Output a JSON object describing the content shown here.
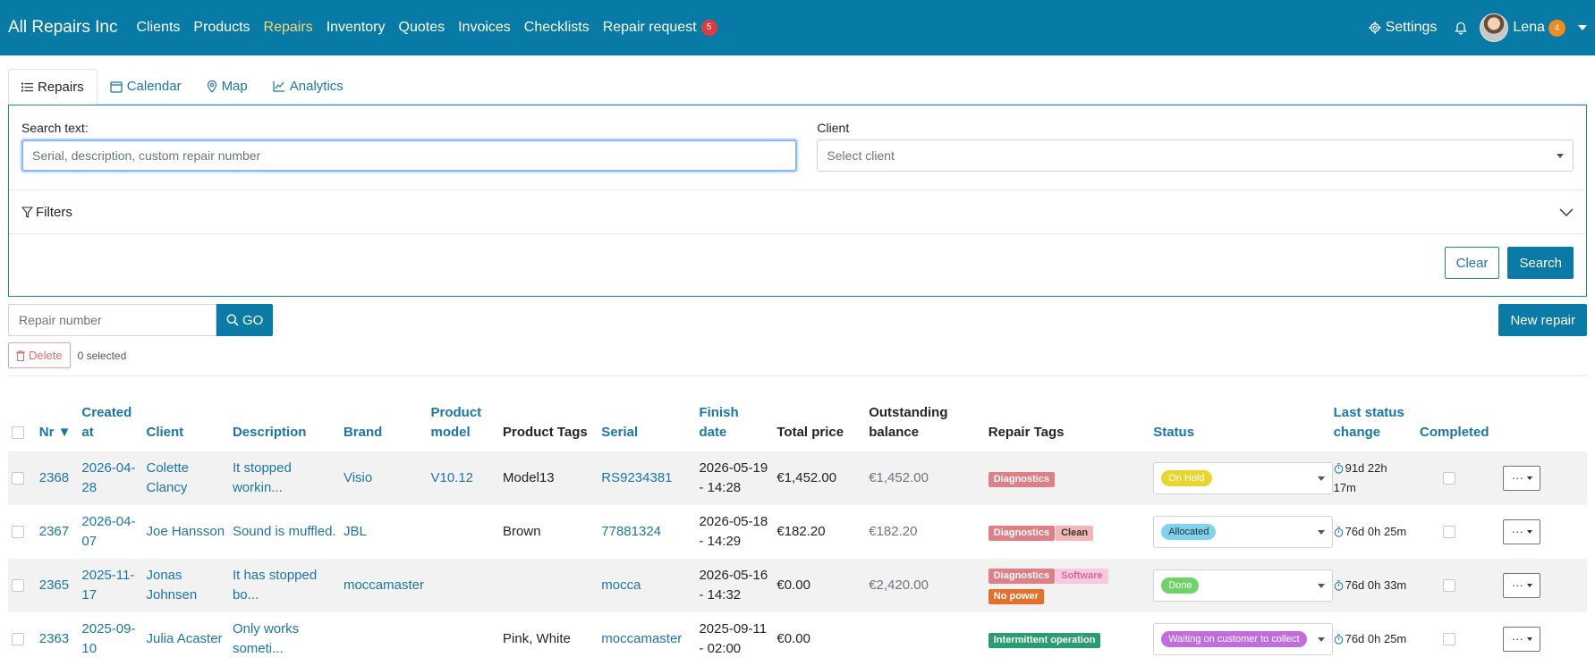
{
  "navbar": {
    "brand": "All Repairs Inc",
    "links": [
      {
        "label": "Clients",
        "active": false
      },
      {
        "label": "Products",
        "active": false
      },
      {
        "label": "Repairs",
        "active": true
      },
      {
        "label": "Inventory",
        "active": false
      },
      {
        "label": "Quotes",
        "active": false
      },
      {
        "label": "Invoices",
        "active": false
      },
      {
        "label": "Checklists",
        "active": false
      }
    ],
    "repair_request_label": "Repair request",
    "repair_request_badge": "5",
    "settings_label": "Settings",
    "user_name": "Lena",
    "user_badge": "4"
  },
  "tabs": [
    {
      "label": "Repairs",
      "icon": "list-icon",
      "active": true
    },
    {
      "label": "Calendar",
      "icon": "calendar-icon",
      "active": false
    },
    {
      "label": "Map",
      "icon": "map-pin-icon",
      "active": false
    },
    {
      "label": "Analytics",
      "icon": "chart-line-icon",
      "active": false
    }
  ],
  "search": {
    "search_label": "Search text:",
    "search_placeholder": "Serial, description, custom repair number",
    "client_label": "Client",
    "client_placeholder": "Select client",
    "filters_label": "Filters",
    "clear_label": "Clear",
    "search_button": "Search"
  },
  "toolbar": {
    "repair_number_placeholder": "Repair number",
    "go_label": "GO",
    "new_repair_label": "New repair",
    "delete_label": "Delete",
    "selected_text": "0 selected"
  },
  "table": {
    "headers": {
      "nr": "Nr ▼",
      "created_at": "Created at",
      "client": "Client",
      "description": "Description",
      "brand": "Brand",
      "product_model": "Product model",
      "product_tags": "Product Tags",
      "serial": "Serial",
      "finish_date": "Finish date",
      "total_price": "Total price",
      "outstanding_balance": "Outstanding balance",
      "repair_tags": "Repair Tags",
      "status": "Status",
      "last_status_change": "Last status change",
      "completed": "Completed"
    },
    "rows": [
      {
        "nr": "2368",
        "created_at": "2026-04-28",
        "client": "Colette Clancy",
        "description": "It stopped workin...",
        "brand": "Visio",
        "product_model": "V10.12",
        "product_tags": "Model13",
        "serial": "RS9234381",
        "finish_date": "2026-05-19 - 14:28",
        "total_price": "€1,452.00",
        "outstanding_balance": "€1,452.00",
        "repair_tags": [
          {
            "label": "Diagnostics",
            "bg": "#e07f85",
            "fg": "#ffffff"
          }
        ],
        "status": {
          "label": "On Hold",
          "bg": "#e9d52f",
          "fg": "#ffffff"
        },
        "last_status_change": "91d 22h 17m"
      },
      {
        "nr": "2367",
        "created_at": "2026-04-07",
        "client": "Joe Hansson",
        "description": "Sound is muffled.",
        "brand": "JBL",
        "product_model": "",
        "product_tags": "Brown",
        "serial": "77881324",
        "finish_date": "2026-05-18 - 14:29",
        "total_price": "€182.20",
        "outstanding_balance": "€182.20",
        "repair_tags": [
          {
            "label": "Diagnostics",
            "bg": "#e07f85",
            "fg": "#ffffff"
          },
          {
            "label": "Clean",
            "bg": "#f2b6b6",
            "fg": "#333333"
          }
        ],
        "status": {
          "label": "Allocated",
          "bg": "#7fd3ea",
          "fg": "#1f2d3a"
        },
        "last_status_change": "76d 0h 25m"
      },
      {
        "nr": "2365",
        "created_at": "2025-11-17",
        "client": "Jonas Johnsen",
        "description": "It has stopped bo...",
        "brand": "moccamaster",
        "product_model": "",
        "product_tags": "",
        "serial": "mocca",
        "finish_date": "2026-05-16 - 14:32",
        "total_price": "€0.00",
        "outstanding_balance": "€2,420.00",
        "repair_tags": [
          {
            "label": "Diagnostics",
            "bg": "#e07f85",
            "fg": "#ffffff"
          },
          {
            "label": "Software",
            "bg": "#f8c9de",
            "fg": "#d06aa0"
          },
          {
            "label": "No power",
            "bg": "#e5702a",
            "fg": "#ffffff"
          }
        ],
        "status": {
          "label": "Done",
          "bg": "#6fd36a",
          "fg": "#ffffff"
        },
        "last_status_change": "76d 0h 33m"
      },
      {
        "nr": "2363",
        "created_at": "2025-09-10",
        "client": "Julia Acaster",
        "description": "Only works someti...",
        "brand": "",
        "product_model": "",
        "product_tags": "Pink, White",
        "serial": "moccamaster",
        "finish_date": "2025-09-11 - 02:00",
        "total_price": "€0.00",
        "outstanding_balance": "",
        "repair_tags": [
          {
            "label": "Intermittent operation",
            "bg": "#2a9d6f",
            "fg": "#ffffff"
          }
        ],
        "status": {
          "label": "Waiting on customer to collect",
          "bg": "#c06de0",
          "fg": "#ffffff"
        },
        "last_status_change": "76d 0h 25m"
      }
    ]
  }
}
